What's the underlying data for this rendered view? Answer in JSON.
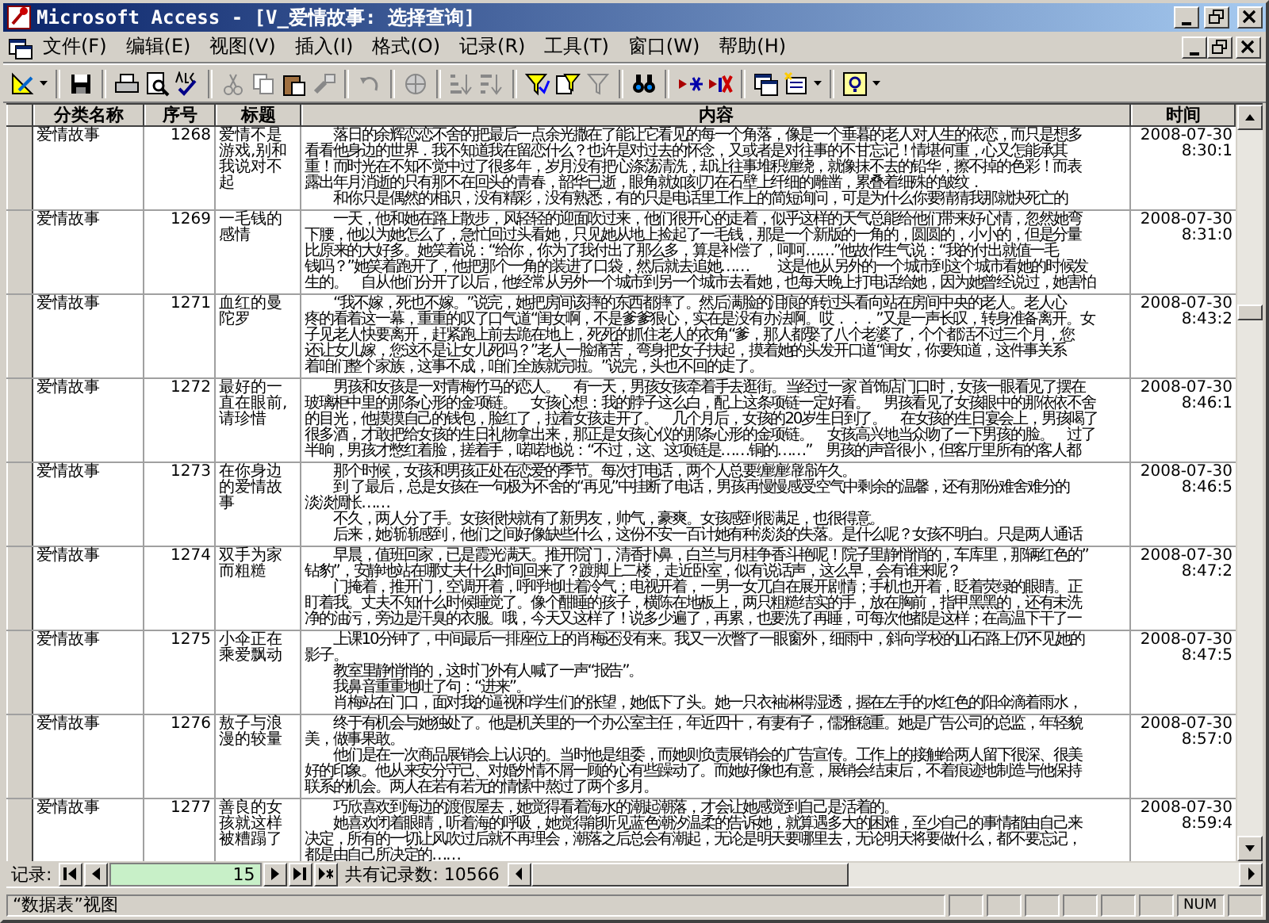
{
  "window": {
    "title": "Microsoft Access - [V_爱情故事: 选择查询]"
  },
  "menu": [
    {
      "label": "文件(F)"
    },
    {
      "label": "编辑(E)"
    },
    {
      "label": "视图(V)"
    },
    {
      "label": "插入(I)"
    },
    {
      "label": "格式(O)"
    },
    {
      "label": "记录(R)"
    },
    {
      "label": "工具(T)"
    },
    {
      "label": "窗口(W)"
    },
    {
      "label": "帮助(H)"
    }
  ],
  "table": {
    "columns": [
      "分类名称",
      "序号",
      "标题",
      "内容",
      "时间"
    ],
    "rows": [
      {
        "category": "爱情故事",
        "number": "1268",
        "title": "爱情不是游戏,别和我说对不起",
        "date": "2008-07-30",
        "time": "8:30:1",
        "content": [
          {
            "text": "落日的余辉恋恋不舍的把最后一点余光撒在了能让它看见的每一个角落，像是一个垂暮的老人对人生的依恋，而只是想多",
            "indent": true
          },
          {
            "text": "看看他身边的世界．我不知道我在留恋什么？也许是对过去的怀念，又或者是对往事的不甘忘记！情堪何重，心又怎能承其",
            "indent": false
          },
          {
            "text": "重！而时光在不知不觉中过了很多年，岁月没有把心涤荡清洗，却让往事堆积缠绕，就像抹不去的铅华，擦不掉的色彩！而表",
            "indent": false
          },
          {
            "text": "露出年月消逝的只有那不在回头的青春，韶华已逝，眼角就如刻刀在石壁上纤细的雕凿，累叠着细殊的皱纹．",
            "indent": false
          },
          {
            "text": "和你只是偶然的相识，没有精彩，没有熟悉，有的只是电话里工作上的简短询问，可是为什么你要猜猜我那就快死亡的",
            "indent": true
          }
        ]
      },
      {
        "category": "爱情故事",
        "number": "1269",
        "title": "一毛钱的感情",
        "date": "2008-07-30",
        "time": "8:31:0",
        "content": [
          {
            "text": "一天，他和她在路上散步，风轻轻的迎面吹过来，他们很开心的走着，似乎这样的天气总能给他们带来好心情，忽然她弯",
            "indent": true
          },
          {
            "text": "下腰，他以为她怎么了，急忙回过头看她，只见她从地上捡起了一毛钱，那是一个新版的一角的，圆圆的，小小的，但是分量",
            "indent": false
          },
          {
            "text": "比原来的大好多。她笑着说：“给你，你为了我付出了那么多，算是补偿了，呵呵……”他故作生气说：“我的付出就值一毛",
            "indent": false
          },
          {
            "text": "钱吗？”她笑着跑开了，他把那个一角的装进了口袋，然后就去追她……　　这是他从另外的一个城市到这个城市看她的时候发",
            "indent": false
          },
          {
            "text": "生的。　自从他们分开了以后，他经常从另外一个城市到另一个城市去看她，也每天晚上打电话给她，因为她曾经说过，她害怕",
            "indent": false
          }
        ]
      },
      {
        "category": "爱情故事",
        "number": "1271",
        "title": "血红的曼陀罗",
        "date": "2008-07-30",
        "time": "8:43:2",
        "content": [
          {
            "text": "“我不嫁，死也不嫁。”说完，她把房间该摔的东西都摔了。然后满脸的泪痕的转过头看向站在房间中央的老人。老人心",
            "indent": true
          },
          {
            "text": "疼的看着这一幕，重重的叹了口气道“闺女啊，不是爹爹狠心，实在是没有办法啊。哎．．．”又是一声长叹，转身准备离开。女",
            "indent": false
          },
          {
            "text": "子见老人快要离开，赶紧跑上前去跪在地上，死死的抓住老人的衣角“爹，那人都娶了八个老婆了，个个都活不过三个月，您",
            "indent": false
          },
          {
            "text": "还让女儿嫁，您这不是让女儿死吗？”老人一脸痛苦，弯身把女子扶起，摸着她的头发开口道“闺女，你要知道，这件事关系",
            "indent": false
          },
          {
            "text": "着咱们整个家族，这事不成，咱们全族就完啦。”说完，头也不回的走了。",
            "indent": false
          }
        ]
      },
      {
        "category": "爱情故事",
        "number": "1272",
        "title": "最好的一直在眼前,请珍惜",
        "date": "2008-07-30",
        "time": "8:46:1",
        "content": [
          {
            "text": "男孩和女孩是一对青梅竹马的恋人。　有一天，男孩女孩牵着手去逛街。当经过一家 首饰店门口时，女孩一眼看见了摆在",
            "indent": true
          },
          {
            "text": "玻璃柜中里的那条心形的金项链。　女孩心想：我的脖子这么白，配上这条项链一定好看。　男孩看见了女孩眼中的那依依不舍",
            "indent": false
          },
          {
            "text": "的目光，他摸摸自己的钱包，脸红了，拉着女孩走开了。　几个月后，女孩的20岁生日到了。　在女孩的生日宴会上，男孩喝了",
            "indent": false
          },
          {
            "text": "很多酒，才敢把给女孩的生日礼物拿出来，那正是女孩心仪的那条心形的金项链。　女孩高兴地当众吻了一下男孩的脸。　过了",
            "indent": false
          },
          {
            "text": "半晌，男孩才憋红着脸，搓着手，喏喏地说：“不过，这、这项链是……铜的……”　男孩的声音很小，但客厅里所有的客人都",
            "indent": false
          }
        ]
      },
      {
        "category": "爱情故事",
        "number": "1273",
        "title": "在你身边的爱情故事",
        "date": "2008-07-30",
        "time": "8:46:5",
        "content": [
          {
            "text": "那个时候，女孩和男孩正处在恋爱的季节。每次打电话，两个人总要缠缠绵绵许久。",
            "indent": true
          },
          {
            "text": "到 了最后，总是女孩在一句极为不舍的“再见”中挂断了电话，男孩再慢慢感受空气中剩余的温馨，还有那份难舍难分的",
            "indent": true
          },
          {
            "text": "淡淡惆怅……",
            "indent": false
          },
          {
            "text": "不久，两人分了手。女孩很快就有了新男友，帅气，豪爽。女孩感到很满足，也很得意。",
            "indent": true
          },
          {
            "text": "后来，她渐渐感到，他们之间好像缺些什么，这份不安一百计她有种淡淡的失落。是什么呢？女孩不明白。只是两人通话",
            "indent": true
          }
        ]
      },
      {
        "category": "爱情故事",
        "number": "1274",
        "title": "双手为家而粗糙",
        "date": "2008-07-30",
        "time": "8:47:2",
        "content": [
          {
            "text": "早晨，值班回家，已是霞光满天。推开院门，清香扑鼻，白兰与月桂争香斗艳呢！院子里静悄悄的，车库里，那辆红色的”",
            "indent": true
          },
          {
            "text": "钻豹”，安静地站在哪丈夫什么时间回来了？踱脚上二楼，走近卧室，似有说话声，这么早，会有谁来呢？",
            "indent": false
          },
          {
            "text": "门掩着，推开门，空调开着，呼呼地吐着冷气；电视开着，一男一女兀自在展开剧情；手机也开着，眨着荧绿的眼睛。正",
            "indent": true
          },
          {
            "text": "盯着我。丈夫不知什么时候睡觉了。像个酣睡的孩子，横陈在地板上，两只粗糙结实的手，放在胸前，指甲黑黑的，还有未洗",
            "indent": false
          },
          {
            "text": "净的油污，旁边是汗臭的衣服。哦，今天又这样了！说多少遍了，再累，也要洗了再睡，可每次他都是这样；在高温下干了一",
            "indent": false
          }
        ]
      },
      {
        "category": "爱情故事",
        "number": "1275",
        "title": "小伞正在乘爱飘动",
        "date": "2008-07-30",
        "time": "8:47:5",
        "content": [
          {
            "text": "上课10分钟了，中间最后一排座位上的肖梅还没有来。我又一次瞥了一眼窗外，细雨中，斜向学校的山石路上仍不见她的",
            "indent": true
          },
          {
            "text": "影子。",
            "indent": false
          },
          {
            "text": "教室里静悄悄的，这时门外有人喊了一声“报告”。",
            "indent": true
          },
          {
            "text": "我鼻音重重地吐了句：“进来”。",
            "indent": true
          },
          {
            "text": "肖梅站在门口，面对我的逼视和学生们的张望，她低下了头。她一只衣袖淋得湿透，握在左手的水红色的阳伞滴着雨水，",
            "indent": true
          }
        ]
      },
      {
        "category": "爱情故事",
        "number": "1276",
        "title": "敖子与浪漫的较量",
        "date": "2008-07-30",
        "time": "8:57:0",
        "content": [
          {
            "text": "终于有机会与她独处了。他是机关里的一个办公室主任，年近四十，有妻有子，儒雅稳重。她是广告公司的总监，年轻貌",
            "indent": true
          },
          {
            "text": "美，做事果敢。",
            "indent": false
          },
          {
            "text": "他们是在一次商品展销会上认识的。当时他是组委，而她则负责展销会的广告宣传。工作上的接触给两人留下很深、很美",
            "indent": true
          },
          {
            "text": "好的印象。他从来安分守己、对婚外情不屑一顾的心有些躁动了。而她好像也有意，展销会结束后，不着痕迹地制造与他保持",
            "indent": false
          },
          {
            "text": "联系的机会。两人在若有若无的情愫中熬过了两个多月。",
            "indent": false
          }
        ]
      },
      {
        "category": "爱情故事",
        "number": "1277",
        "title": "善良的女孩就这样被糟蹋了",
        "date": "2008-07-30",
        "time": "8:59:4",
        "content": [
          {
            "text": "巧欣喜欢到海边的渡假屋去，她觉得看着海水的潮起潮落，才会让她感觉到自己是活着的。",
            "indent": true
          },
          {
            "text": "她喜欢闭着眼睛，听着海的呼吸，她觉得能听见蓝色潮汐温柔的告诉她，就算遇多大的困难，至少自己的事情都由自己来",
            "indent": true
          },
          {
            "text": "决定，所有的一切让风吹过后就不再理会，潮落之后总会有潮起，无论是明天要哪里去，无论明天将要做什么，都不要忘记，",
            "indent": false
          },
          {
            "text": "都是由自己所决定的……",
            "indent": false
          }
        ]
      }
    ]
  },
  "navigation": {
    "label": "记录:",
    "current": "15",
    "total": "共有记录数: 10566"
  },
  "status_bar": {
    "view": "“数据表”视图",
    "indicators": [
      "NUM"
    ]
  }
}
